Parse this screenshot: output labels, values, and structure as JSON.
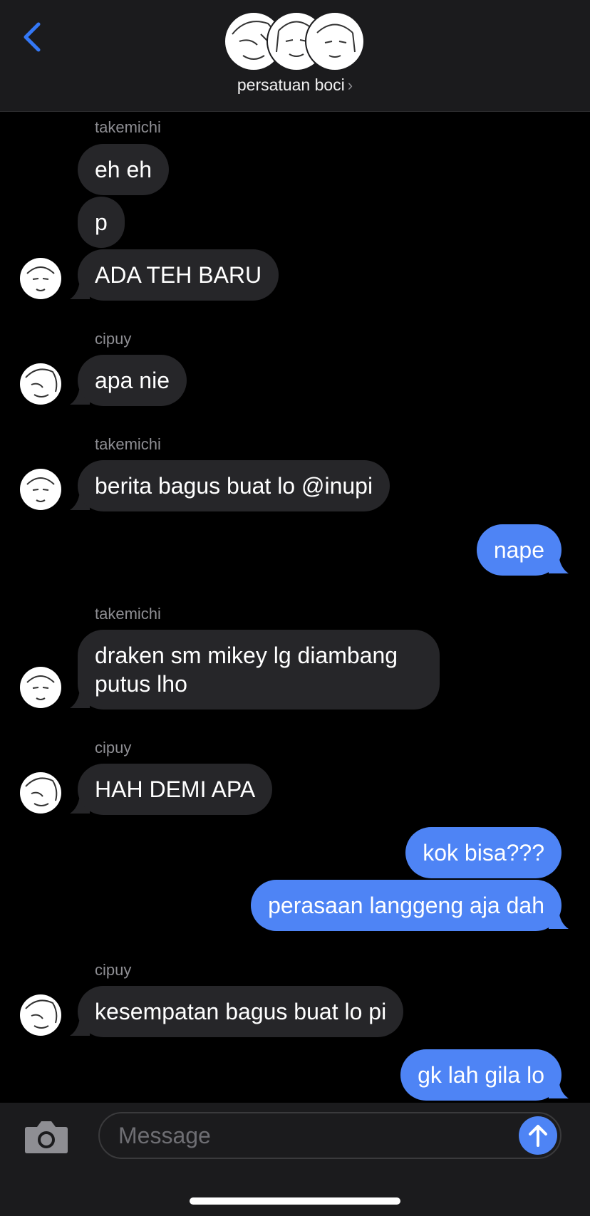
{
  "header": {
    "back_icon": "chevron-left-icon",
    "group_name": "persatuan boci",
    "chevron": "›",
    "accent": "#3478f6"
  },
  "messages": [
    {
      "sender": "takemichi"
    },
    {
      "text": "eh eh",
      "dir": "in"
    },
    {
      "text": "p",
      "dir": "in"
    },
    {
      "text": "ADA TEH BARU",
      "dir": "in"
    },
    {
      "sender": "cipuy"
    },
    {
      "text": "apa nie",
      "dir": "in"
    },
    {
      "sender": "takemichi"
    },
    {
      "text": "berita bagus buat lo @inupi",
      "dir": "in"
    },
    {
      "text": "nape",
      "dir": "out"
    },
    {
      "sender": "takemichi"
    },
    {
      "text": "draken sm mikey lg diambang putus lho",
      "dir": "in"
    },
    {
      "sender": "cipuy"
    },
    {
      "text": "HAH DEMI APA",
      "dir": "in"
    },
    {
      "text": "kok bisa???",
      "dir": "out"
    },
    {
      "text": "perasaan langgeng aja dah",
      "dir": "out"
    },
    {
      "sender": "cipuy"
    },
    {
      "text": "kesempatan bagus buat lo pi",
      "dir": "in"
    },
    {
      "text": "gk lah gila lo",
      "dir": "out"
    }
  ],
  "composer": {
    "placeholder": "Message",
    "camera_icon": "camera-icon",
    "send_icon": "arrow-up-icon"
  },
  "colors": {
    "incoming_bubble": "#262629",
    "outgoing_bubble": "#4e84f5",
    "background": "#000000"
  }
}
